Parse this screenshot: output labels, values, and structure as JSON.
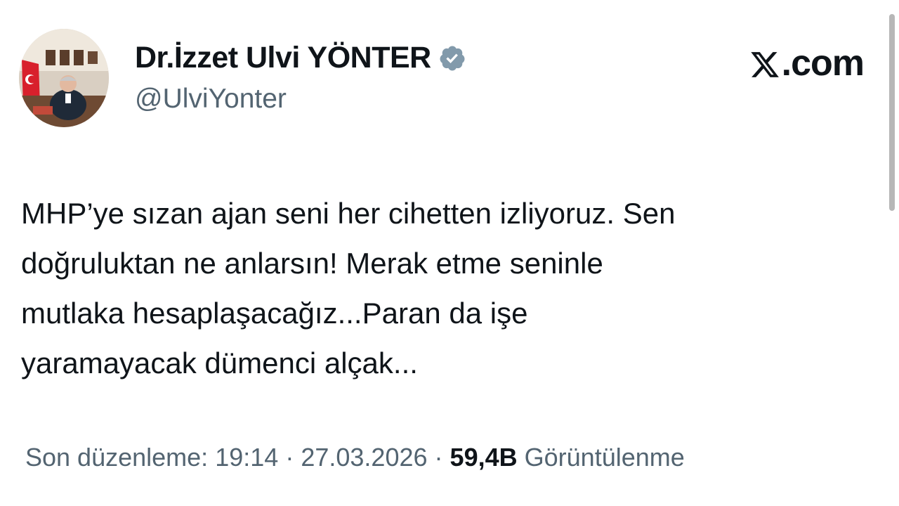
{
  "brand": {
    "label": ".com",
    "logo_icon": "x-logo-icon"
  },
  "author": {
    "name": "Dr.İzzet Ulvi YÖNTER",
    "handle": "@UlviYonter",
    "verified_icon": "verified-badge-icon",
    "verified_color": "#829aab"
  },
  "tweet": {
    "lines": [
      "MHP’ye sızan ajan seni her cihetten izliyoruz. Sen",
      "doğruluktan ne anlarsın! Merak etme seninle",
      "mutlaka hesaplaşacağız...Paran da işe",
      "yaramayacak dümenci alçak..."
    ]
  },
  "meta": {
    "edited_label": "Son düzenleme:",
    "time": "19:14",
    "date": "27.03.2026",
    "separator": "·",
    "views_count": "59,4B",
    "views_label": "Görüntülenme"
  },
  "colors": {
    "text": "#0f1419",
    "secondary": "#536471",
    "background": "#ffffff"
  }
}
